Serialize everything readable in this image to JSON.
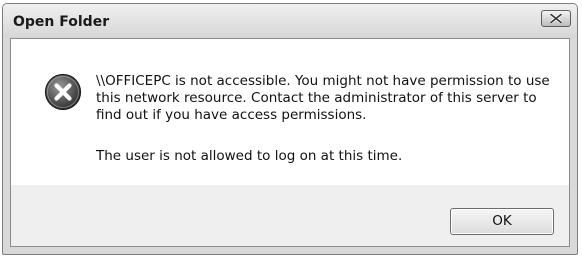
{
  "dialog": {
    "title": "Open Folder",
    "icon": "error-icon",
    "message": "\\\\OFFICEPC is not accessible. You might not have permission to use this network resource. Contact the administrator of this server to find out if you have access permissions.",
    "detail": "The user is not allowed to log on at this time.",
    "ok_label": "OK"
  }
}
